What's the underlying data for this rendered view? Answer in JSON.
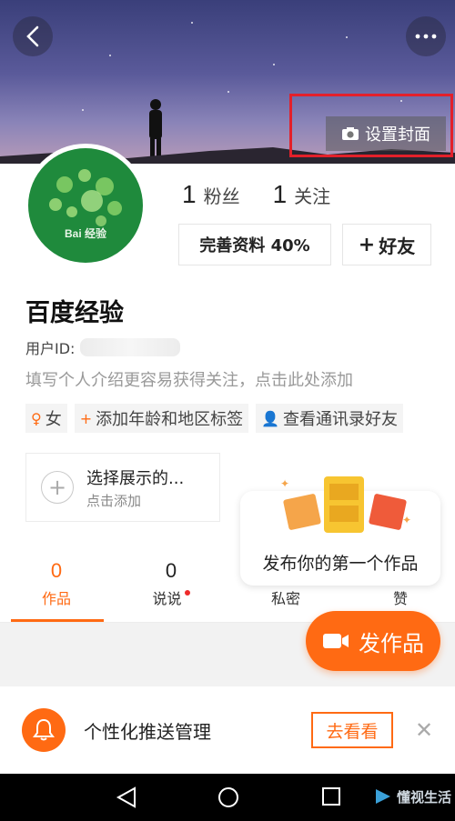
{
  "cover": {
    "set_cover_label": "设置封面"
  },
  "profile": {
    "fans_count": "1",
    "fans_label": "粉丝",
    "follow_count": "1",
    "follow_label": "关注",
    "complete_label": "完善资料 40%",
    "add_friend_label": "好友",
    "name": "百度经验",
    "uid_label": "用户ID:",
    "intro": "填写个人介绍更容易获得关注，点击此处添加",
    "avatar_logo_text": "Bai 经验",
    "tags": [
      {
        "icon": "female-icon",
        "label": "女"
      },
      {
        "icon": "plus-icon",
        "label": "添加年龄和地区标签"
      },
      {
        "icon": "contacts-icon",
        "label": "查看通讯录好友"
      }
    ],
    "showcase": {
      "title": "选择展示的...",
      "subtitle": "点击添加"
    }
  },
  "tabs": [
    {
      "count": "0",
      "label": "作品",
      "active": true
    },
    {
      "count": "0",
      "label": "说说",
      "dot": true
    },
    {
      "count": "",
      "label": "私密"
    },
    {
      "count": "",
      "label": "赞"
    }
  ],
  "tooltip": {
    "text": "发布你的第一个作品"
  },
  "publish": {
    "label": "发作品"
  },
  "push": {
    "text": "个性化推送管理",
    "button": "去看看"
  },
  "watermark": {
    "text": "懂视生活"
  },
  "colors": {
    "accent": "#ff6a13",
    "highlight_box": "#e3202a"
  }
}
